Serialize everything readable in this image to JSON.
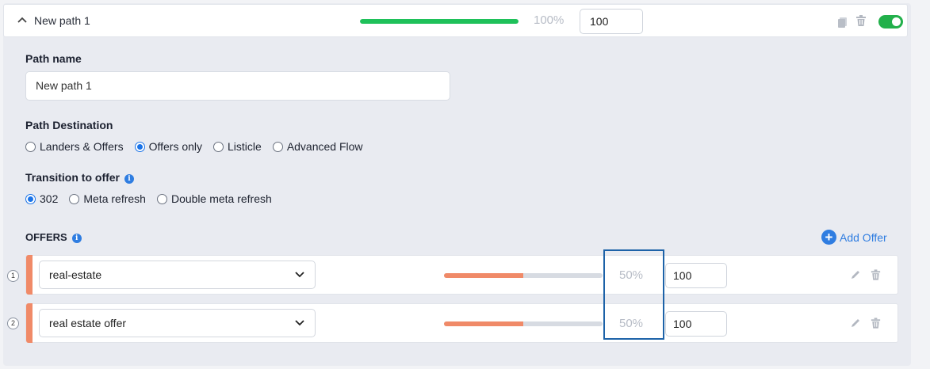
{
  "path": {
    "title": "New path 1",
    "percent": "100%",
    "weight": "100",
    "progress": 1.0,
    "enabled": true,
    "progress_color": "#1fc15a"
  },
  "form": {
    "path_name_label": "Path name",
    "path_name_value": "New path 1",
    "destination_label": "Path Destination",
    "destination_options": [
      "Landers & Offers",
      "Offers only",
      "Listicle",
      "Advanced Flow"
    ],
    "destination_selected": "Offers only",
    "transition_label": "Transition to offer",
    "transition_options": [
      "302",
      "Meta refresh",
      "Double meta refresh"
    ],
    "transition_selected": "302"
  },
  "offers": {
    "label": "OFFERS",
    "add_label": "Add Offer",
    "accent_color": "#f08a68",
    "items": [
      {
        "index": "1",
        "name": "real-estate",
        "percent": "50%",
        "weight": "100",
        "share": 0.5
      },
      {
        "index": "2",
        "name": "real estate offer",
        "percent": "50%",
        "weight": "100",
        "share": 0.5
      }
    ]
  },
  "icons": [
    "chevron-up-icon",
    "copy-icon",
    "trash-icon",
    "toggle-switch",
    "info-icon",
    "plus-circle-icon",
    "chevron-down-icon",
    "pencil-icon"
  ],
  "highlight_color": "#1d62a8"
}
